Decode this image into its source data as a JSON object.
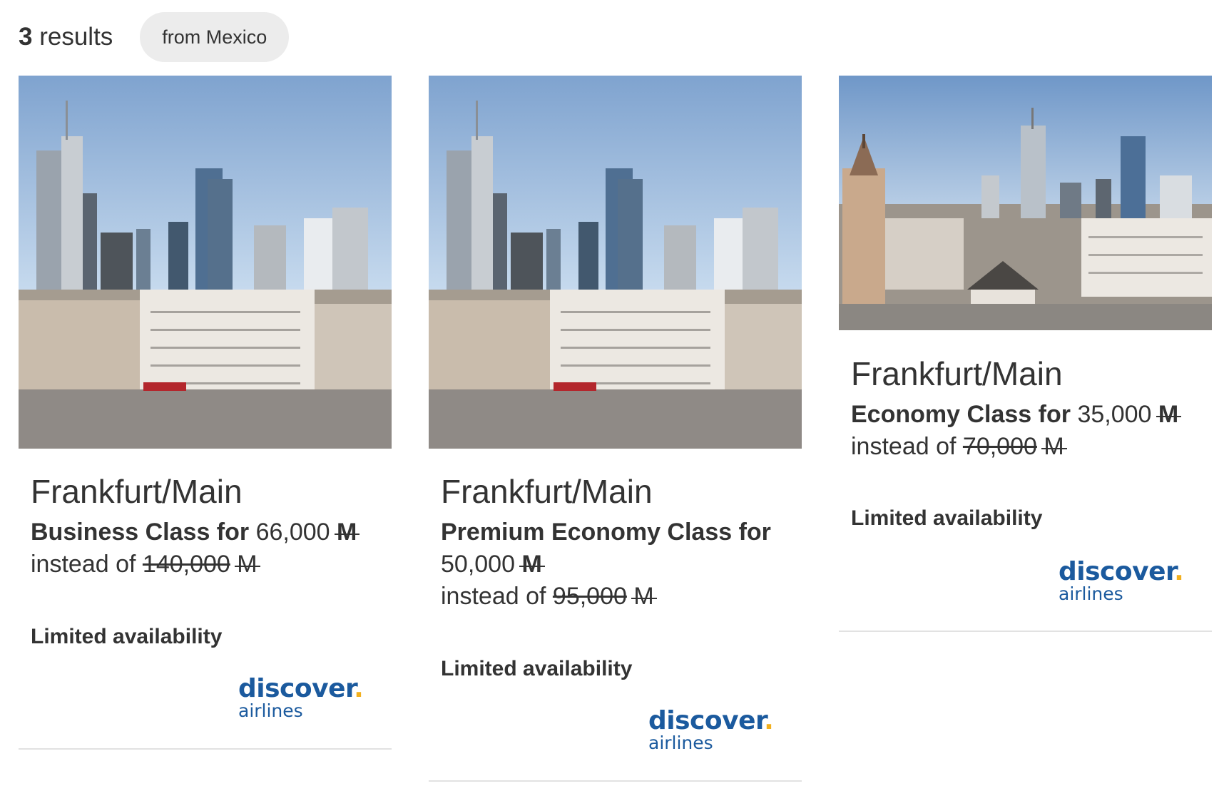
{
  "header": {
    "results_count": "3",
    "results_label": "results",
    "filter_chip": "from Mexico"
  },
  "colors": {
    "text": "#333333",
    "chip_bg": "#ececec",
    "logo_blue": "#1b5a9e",
    "logo_dot": "#f2b01e",
    "divider": "#e2e2e2"
  },
  "cards": [
    {
      "city": "Frankfurt/Main",
      "class_label": "Business Class for",
      "price": "66,000",
      "instead_of_label": "instead of",
      "old_price": "140,000",
      "currency_symbol": "M",
      "availability": "Limited availability",
      "airline_brand": "discover",
      "airline_sub": "airlines",
      "image_icon": "frankfurt-skyline-photo"
    },
    {
      "city": "Frankfurt/Main",
      "class_label": "Premium Economy Class for",
      "price": "50,000",
      "instead_of_label": "instead of",
      "old_price": "95,000",
      "currency_symbol": "M",
      "availability": "Limited availability",
      "airline_brand": "discover",
      "airline_sub": "airlines",
      "image_icon": "frankfurt-skyline-photo"
    },
    {
      "city": "Frankfurt/Main",
      "class_label": "Economy Class for",
      "price": "35,000",
      "instead_of_label": "instead of",
      "old_price": "70,000",
      "currency_symbol": "M",
      "availability": "Limited availability",
      "airline_brand": "discover",
      "airline_sub": "airlines",
      "image_icon": "frankfurt-hauptwache-photo"
    }
  ]
}
